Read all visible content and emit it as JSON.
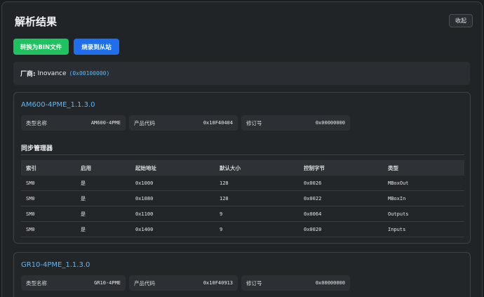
{
  "header": {
    "title": "解析结果",
    "collapse_label": "收起"
  },
  "actions": {
    "convert_bin_label": "转换为BIN文件",
    "flash_slave_label": "烧录到从站"
  },
  "vendor": {
    "label": "厂商:",
    "name": "Inovance",
    "code": "(0x00100000)"
  },
  "devices": [
    {
      "name": "AM600-4PME_1.1.3.0",
      "fields": [
        {
          "label": "类型名称",
          "value": "AM600-4PME"
        },
        {
          "label": "产品代码",
          "value": "0x10F40404"
        },
        {
          "label": "修订号",
          "value": "0x00000000"
        }
      ],
      "sync_manager_title": "同步管理器",
      "table": {
        "headers": [
          "索引",
          "启用",
          "起始地址",
          "默认大小",
          "控制字节",
          "类型"
        ],
        "rows": [
          [
            "SM0",
            "是",
            "0x1000",
            "128",
            "0x0026",
            "MBoxOut"
          ],
          [
            "SM0",
            "是",
            "0x1080",
            "128",
            "0x0022",
            "MBoxIn"
          ],
          [
            "SM0",
            "是",
            "0x1100",
            "9",
            "0x0064",
            "Outputs"
          ],
          [
            "SM0",
            "是",
            "0x1400",
            "9",
            "0x0020",
            "Inputs"
          ]
        ]
      }
    },
    {
      "name": "GR10-4PME_1.1.3.0",
      "fields": [
        {
          "label": "类型名称",
          "value": "GR10-4PME"
        },
        {
          "label": "产品代码",
          "value": "0x10F40913"
        },
        {
          "label": "修订号",
          "value": "0x00000000"
        }
      ]
    }
  ]
}
